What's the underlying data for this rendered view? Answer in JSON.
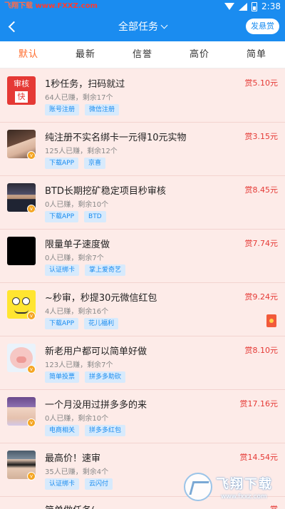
{
  "status_bar": {
    "site_label": "飞翔下载",
    "site_url": "www.FXXZ.com",
    "time": "2:38"
  },
  "nav": {
    "title": "全部任务",
    "publish_label": "发悬赏"
  },
  "tabs": [
    {
      "label": "默认",
      "active": true
    },
    {
      "label": "最新",
      "active": false
    },
    {
      "label": "信誉",
      "active": false
    },
    {
      "label": "高价",
      "active": false
    },
    {
      "label": "简单",
      "active": false
    }
  ],
  "tasks": [
    {
      "title": "1秒任务，扫码就过",
      "meta": "64人已赚，剩余17个",
      "tags": [
        "账号注册",
        "微信注册"
      ],
      "reward": "赏5.10元",
      "avatar": "review-badge",
      "avatar_text": [
        "审核",
        "快"
      ]
    },
    {
      "title": "纯注册不实名绑卡一元得10元实物",
      "meta": "125人已赚，剩余12个",
      "tags": [
        "下载APP",
        "京喜"
      ],
      "reward": "赏3.15元",
      "avatar": "girl-photo"
    },
    {
      "title": "BTD长期挖矿稳定项目秒审核",
      "meta": "0人已赚，剩余10个",
      "tags": [
        "下载APP",
        "BTD"
      ],
      "reward": "赏8.45元",
      "avatar": "man-photo"
    },
    {
      "title": "限量单子速度做",
      "meta": "0人已赚，剩余7个",
      "tags": [
        "认证绑卡",
        "掌上爱奇艺"
      ],
      "reward": "赏7.74元",
      "avatar": "black-square"
    },
    {
      "title": "~秒审，秒提30元微信红包",
      "meta": "4人已赚，剩余16个",
      "tags": [
        "下载APP",
        "花儿福利"
      ],
      "reward": "赏9.24元",
      "avatar": "spongebob",
      "envelope": true
    },
    {
      "title": "新老用户都可以简单好做",
      "meta": "123人已赚，剩余7个",
      "tags": [
        "简单投票",
        "拼多多助砍"
      ],
      "reward": "赏8.10元",
      "avatar": "pig-cartoon"
    },
    {
      "title": "一个月没用过拼多多的来",
      "meta": "0人已赚，剩余10个",
      "tags": [
        "电商相关",
        "拼多多红包"
      ],
      "reward": "赏17.16元",
      "avatar": "face-photo"
    },
    {
      "title": "最高价！速审",
      "meta": "35人已赚，剩余4个",
      "tags": [
        "认证绑卡",
        "云闪付"
      ],
      "reward": "赏14.54元",
      "avatar": "sunglasses-photo"
    }
  ],
  "partial_item": {
    "title": "简单做任务(",
    "reward": "赏"
  },
  "watermark": {
    "name": "飞翔下载",
    "url": "www.fxxz.com"
  },
  "colors": {
    "primary": "#1a8cf0",
    "accent": "#ff6a2a",
    "reward": "#e53935",
    "tag_bg": "#d7eafc"
  }
}
